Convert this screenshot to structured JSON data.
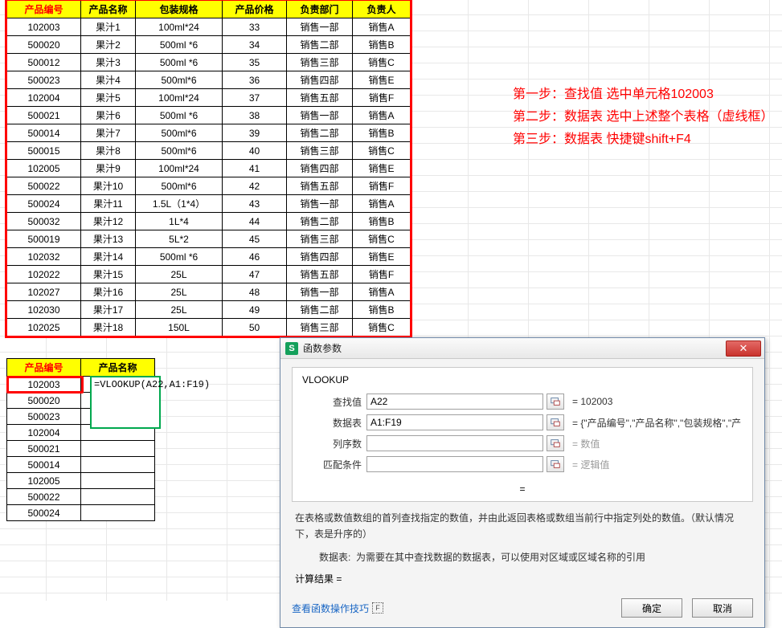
{
  "main_table": {
    "headers": [
      "产品编号",
      "产品名称",
      "包装规格",
      "产品价格",
      "负责部门",
      "负责人"
    ],
    "rows": [
      [
        "102003",
        "果汁1",
        "100ml*24",
        "33",
        "销售一部",
        "销售A"
      ],
      [
        "500020",
        "果汁2",
        "500ml *6",
        "34",
        "销售二部",
        "销售B"
      ],
      [
        "500012",
        "果汁3",
        "500ml *6",
        "35",
        "销售三部",
        "销售C"
      ],
      [
        "500023",
        "果汁4",
        "500ml*6",
        "36",
        "销售四部",
        "销售E"
      ],
      [
        "102004",
        "果汁5",
        "100ml*24",
        "37",
        "销售五部",
        "销售F"
      ],
      [
        "500021",
        "果汁6",
        "500ml *6",
        "38",
        "销售一部",
        "销售A"
      ],
      [
        "500014",
        "果汁7",
        "500ml*6",
        "39",
        "销售二部",
        "销售B"
      ],
      [
        "500015",
        "果汁8",
        "500ml*6",
        "40",
        "销售三部",
        "销售C"
      ],
      [
        "102005",
        "果汁9",
        "100ml*24",
        "41",
        "销售四部",
        "销售E"
      ],
      [
        "500022",
        "果汁10",
        "500ml*6",
        "42",
        "销售五部",
        "销售F"
      ],
      [
        "500024",
        "果汁11",
        "1.5L（1*4）",
        "43",
        "销售一部",
        "销售A"
      ],
      [
        "500032",
        "果汁12",
        "1L*4",
        "44",
        "销售二部",
        "销售B"
      ],
      [
        "500019",
        "果汁13",
        "5L*2",
        "45",
        "销售三部",
        "销售C"
      ],
      [
        "102032",
        "果汁14",
        "500ml *6",
        "46",
        "销售四部",
        "销售E"
      ],
      [
        "102022",
        "果汁15",
        "25L",
        "47",
        "销售五部",
        "销售F"
      ],
      [
        "102027",
        "果汁16",
        "25L",
        "48",
        "销售一部",
        "销售A"
      ],
      [
        "102030",
        "果汁17",
        "25L",
        "49",
        "销售二部",
        "销售B"
      ],
      [
        "102025",
        "果汁18",
        "150L",
        "50",
        "销售三部",
        "销售C"
      ]
    ]
  },
  "steps": {
    "s1": "第一步：查找值 选中单元格102003",
    "s2": "第二步：数据表 选中上述整个表格（虚线框）",
    "s3": "第三步：数据表  快捷键shift+F4"
  },
  "small_table": {
    "headers": [
      "产品编号",
      "产品名称"
    ],
    "ids": [
      "102003",
      "500020",
      "500023",
      "102004",
      "500021",
      "500014",
      "102005",
      "500022",
      "500024"
    ]
  },
  "formula_text": "=VLOOKUP(A22,A1:F19)",
  "dialog": {
    "title": "函数参数",
    "fn_name": "VLOOKUP",
    "rows": [
      {
        "label": "查找值",
        "value": "A22",
        "result": "= 102003",
        "grey": false,
        "has_input": true
      },
      {
        "label": "数据表",
        "value": "A1:F19",
        "result": "= {\"产品编号\",\"产品名称\",\"包装规格\",\"产品...",
        "grey": false,
        "has_input": true
      },
      {
        "label": "列序数",
        "value": "",
        "result": "= 数值",
        "grey": true,
        "has_input": true
      },
      {
        "label": "匹配条件",
        "value": "",
        "result": "= 逻辑值",
        "grey": true,
        "has_input": true
      }
    ],
    "center_eq": "=",
    "desc": "在表格或数值数组的首列查找指定的数值，并由此返回表格或数组当前行中指定列处的数值。（默认情况下，表是升序的）",
    "sub_label": "数据表:",
    "sub_text": "为需要在其中查找数据的数据表，可以使用对区域或区域名称的引用",
    "calc_label": "计算结果 =",
    "link": "查看函数操作技巧",
    "ok": "确定",
    "cancel": "取消"
  }
}
